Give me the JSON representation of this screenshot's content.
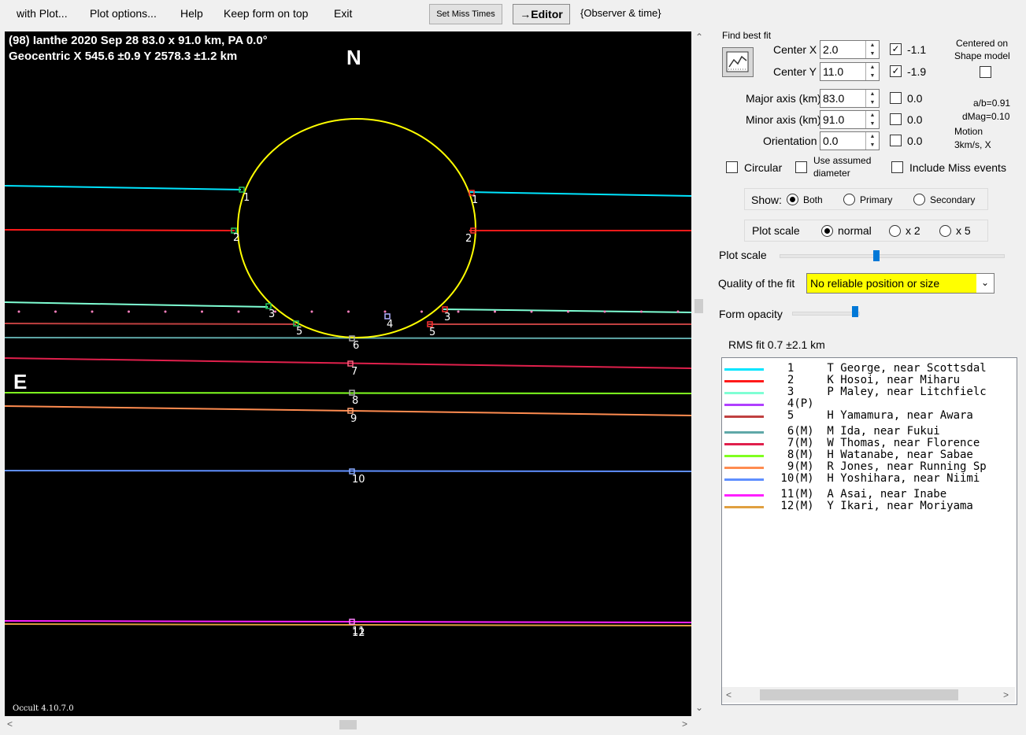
{
  "menu": {
    "with_plot": "with Plot...",
    "plot_options": "Plot options...",
    "help": "Help",
    "keep_on_top": "Keep form on top",
    "exit": "Exit",
    "set_miss_times": "Set Miss Times",
    "editor": "→Editor",
    "observer_time": "{Observer & time}"
  },
  "plot": {
    "title_line1": "(98) Ianthe  2020 Sep 28   83.0 x 91.0 km, PA 0.0°",
    "title_line2": "Geocentric  X  545.6 ±0.9  Y 2578.3 ±1.2 km",
    "north_label": "N",
    "east_label": "E",
    "version": "Occult 4.10.7.0",
    "chord_labels": [
      "1",
      "2",
      "3",
      "4",
      "5",
      "6",
      "7",
      "8",
      "9",
      "10",
      "11",
      "12"
    ]
  },
  "panel": {
    "find_best_fit": "Find best fit",
    "center_x_label": "Center X",
    "center_x": "2.0",
    "center_x_fit": "-1.1",
    "center_y_label": "Center Y",
    "center_y": "11.0",
    "center_y_fit": "-1.9",
    "centered_on": "Centered on",
    "shape_model": "Shape model",
    "major_label": "Major axis (km)",
    "major": "83.0",
    "major_fit": "0.0",
    "minor_label": "Minor axis (km)",
    "minor": "91.0",
    "minor_fit": "0.0",
    "orient_label": "Orientation",
    "orient": "0.0",
    "orient_fit": "0.0",
    "ab_ratio": "a/b=0.91",
    "dmag": "dMag=0.10",
    "motion": "Motion",
    "motion_val": "3km/s, X",
    "circular": "Circular",
    "use_assumed_1": "Use assumed",
    "use_assumed_2": "diameter",
    "include_miss": "Include Miss events",
    "show_label": "Show:",
    "show_both": "Both",
    "show_primary": "Primary",
    "show_secondary": "Secondary",
    "plot_scale_group": "Plot scale",
    "scale_normal": "normal",
    "scale_x2": "x 2",
    "scale_x5": "x 5",
    "plot_scale_slider": "Plot scale",
    "quality_label": "Quality of the fit",
    "quality_value": "No reliable position or size",
    "form_opacity": "Form opacity",
    "rms_fit": "RMS fit  0.7 ±2.1 km"
  },
  "observers": [
    {
      "num": "  1   ",
      "name": "T George, near Scottsdal",
      "color": "#00e5ff"
    },
    {
      "num": "  2   ",
      "name": "K Hosoi, near Miharu",
      "color": "#ff1a1a"
    },
    {
      "num": "  3   ",
      "name": "P Maley, near Litchfielc",
      "color": "#7fffd4"
    },
    {
      "num": "  4(P)",
      "name": "",
      "color": "#b040ff"
    },
    {
      "num": "  5   ",
      "name": "H Yamamura, near Awara",
      "color": "#c04040"
    },
    {
      "num": "  6(M)",
      "name": "M Ida, near Fukui",
      "color": "#5fa8a8"
    },
    {
      "num": "  7(M)",
      "name": "W Thomas, near Florence",
      "color": "#e0204c"
    },
    {
      "num": "  8(M)",
      "name": "H Watanabe, near Sabae",
      "color": "#80ff20"
    },
    {
      "num": "  9(M)",
      "name": "R Jones, near Running Sp",
      "color": "#ff8c50"
    },
    {
      "num": " 10(M)",
      "name": "H Yoshihara, near Niimi",
      "color": "#5f8fff"
    },
    {
      "num": " 11(M)",
      "name": "A Asai, near Inabe",
      "color": "#ff20ff"
    },
    {
      "num": " 12(M)",
      "name": "Y Ikari, near Moriyama",
      "color": "#e0a040"
    }
  ],
  "colors": {
    "ellipse": "#ffff00",
    "quality_bg": "#ffff00"
  }
}
